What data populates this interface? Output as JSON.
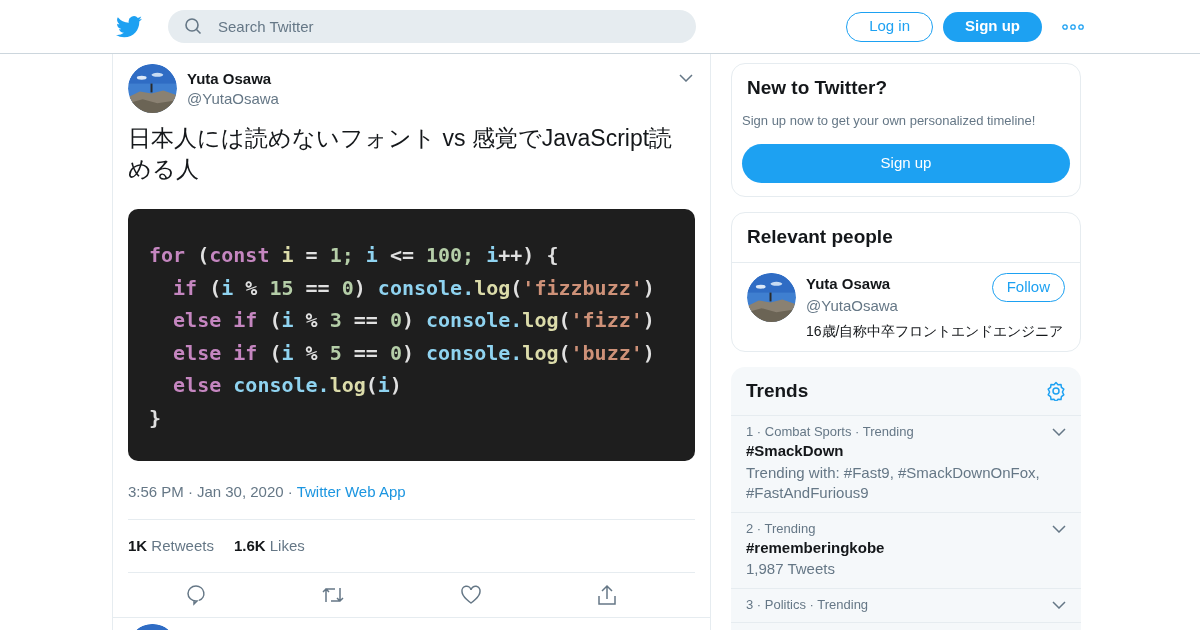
{
  "header": {
    "search": {
      "placeholder": "Search Twitter"
    },
    "login": "Log in",
    "signup": "Sign up"
  },
  "tweet": {
    "name": "Yuta Osawa",
    "handle": "@YutaOsawa",
    "text": "日本人には読めないフォント vs 感覚でJavaScript読める人",
    "code": [
      [
        {
          "text": "for ",
          "color": "#c586c0"
        },
        {
          "text": "(",
          "color": "#e0e0e0"
        },
        {
          "text": "const ",
          "color": "#c586c0"
        },
        {
          "text": "i ",
          "color": "#dcdcaa"
        },
        {
          "text": "= ",
          "color": "#e0e0e0"
        },
        {
          "text": "1; ",
          "color": "#b5cea8"
        },
        {
          "text": "i ",
          "color": "#8fd3f0"
        },
        {
          "text": "<= ",
          "color": "#e0e0e0"
        },
        {
          "text": "100; ",
          "color": "#b5cea8"
        },
        {
          "text": "i",
          "color": "#8fd3f0"
        },
        {
          "text": "++) {",
          "color": "#e0e0e0"
        }
      ],
      [
        {
          "text": "  if ",
          "color": "#c586c0"
        },
        {
          "text": "(",
          "color": "#e0e0e0"
        },
        {
          "text": "i ",
          "color": "#8fd3f0"
        },
        {
          "text": "% ",
          "color": "#e0e0e0"
        },
        {
          "text": "15 ",
          "color": "#b5cea8"
        },
        {
          "text": "== ",
          "color": "#e0e0e0"
        },
        {
          "text": "0",
          "color": "#b5cea8"
        },
        {
          "text": ") ",
          "color": "#e0e0e0"
        },
        {
          "text": "console.",
          "color": "#8fd3f0"
        },
        {
          "text": "log",
          "color": "#dcdcaa"
        },
        {
          "text": "(",
          "color": "#e0e0e0"
        },
        {
          "text": "'fizzbuzz'",
          "color": "#ce9178"
        },
        {
          "text": ")",
          "color": "#e0e0e0"
        }
      ],
      [
        {
          "text": "  else if ",
          "color": "#c586c0"
        },
        {
          "text": "(",
          "color": "#e0e0e0"
        },
        {
          "text": "i ",
          "color": "#8fd3f0"
        },
        {
          "text": "% ",
          "color": "#e0e0e0"
        },
        {
          "text": "3 ",
          "color": "#b5cea8"
        },
        {
          "text": "== ",
          "color": "#e0e0e0"
        },
        {
          "text": "0",
          "color": "#b5cea8"
        },
        {
          "text": ") ",
          "color": "#e0e0e0"
        },
        {
          "text": "console.",
          "color": "#8fd3f0"
        },
        {
          "text": "log",
          "color": "#dcdcaa"
        },
        {
          "text": "(",
          "color": "#e0e0e0"
        },
        {
          "text": "'fizz'",
          "color": "#ce9178"
        },
        {
          "text": ")",
          "color": "#e0e0e0"
        }
      ],
      [
        {
          "text": "  else if ",
          "color": "#c586c0"
        },
        {
          "text": "(",
          "color": "#e0e0e0"
        },
        {
          "text": "i ",
          "color": "#8fd3f0"
        },
        {
          "text": "% ",
          "color": "#e0e0e0"
        },
        {
          "text": "5 ",
          "color": "#b5cea8"
        },
        {
          "text": "== ",
          "color": "#e0e0e0"
        },
        {
          "text": "0",
          "color": "#b5cea8"
        },
        {
          "text": ") ",
          "color": "#e0e0e0"
        },
        {
          "text": "console.",
          "color": "#8fd3f0"
        },
        {
          "text": "log",
          "color": "#dcdcaa"
        },
        {
          "text": "(",
          "color": "#e0e0e0"
        },
        {
          "text": "'buzz'",
          "color": "#ce9178"
        },
        {
          "text": ")",
          "color": "#e0e0e0"
        }
      ],
      [
        {
          "text": "  else ",
          "color": "#c586c0"
        },
        {
          "text": "console.",
          "color": "#8fd3f0"
        },
        {
          "text": "log",
          "color": "#dcdcaa"
        },
        {
          "text": "(",
          "color": "#e0e0e0"
        },
        {
          "text": "i",
          "color": "#8fd3f0"
        },
        {
          "text": ")",
          "color": "#e0e0e0"
        }
      ],
      [
        {
          "text": "}",
          "color": "#e0e0e0"
        }
      ]
    ],
    "separator": "·",
    "time": "3:56 PM",
    "date": "Jan 30, 2020",
    "source": "Twitter Web App",
    "stats": [
      {
        "count": "1K",
        "label": "Retweets"
      },
      {
        "count": "1.6K",
        "label": "Likes"
      }
    ]
  },
  "new_to_twitter": {
    "title": "New to Twitter?",
    "text": "Sign up now to get your own personalized timeline!",
    "button": "Sign up"
  },
  "relevant_people": {
    "title": "Relevant people",
    "person": {
      "name": "Yuta Osawa",
      "handle": "@YutaOsawa",
      "bio": "16歳/自称中卒フロントエンドエンジニア",
      "button": "Follow"
    }
  },
  "trends": {
    "title": "Trends",
    "items": [
      {
        "meta": "1 · Combat Sports · Trending",
        "name": "#SmackDown",
        "detail": "Trending with: #Fast9, #SmackDownOnFox, #FastAndFurious9"
      },
      {
        "meta": "2 · Trending",
        "name": "#rememberingkobe",
        "detail": "1,987 Tweets"
      },
      {
        "meta": "3 · Politics · Trending"
      }
    ]
  }
}
